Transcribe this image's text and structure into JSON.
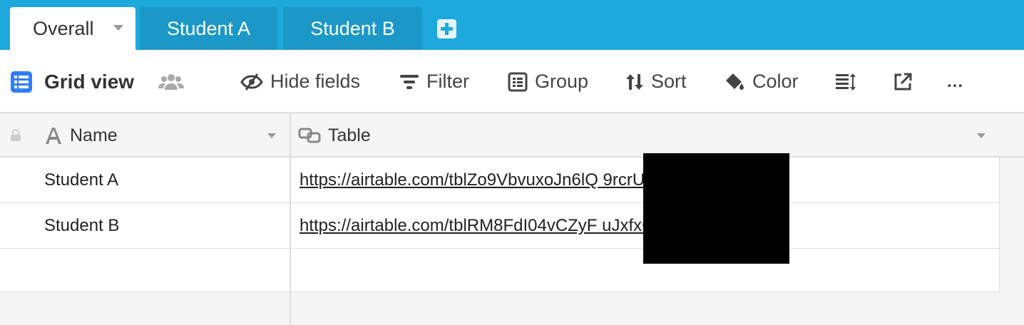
{
  "tabs": [
    {
      "label": "Overall",
      "active": true
    },
    {
      "label": "Student A",
      "active": false
    },
    {
      "label": "Student B",
      "active": false
    }
  ],
  "toolbar": {
    "view_name": "Grid view",
    "hide_fields": "Hide fields",
    "filter": "Filter",
    "group": "Group",
    "sort": "Sort",
    "color": "Color",
    "more": "..."
  },
  "columns": [
    {
      "label": "Name",
      "icon": "text-field-icon"
    },
    {
      "label": "Table",
      "icon": "link-field-icon"
    }
  ],
  "rows": [
    {
      "name": "Student A",
      "url": "https://airtable.com/tblZo9VbvuxoJn6lQ                    9rcrU?blocks=hide"
    },
    {
      "name": "Student B",
      "url": "https://airtable.com/tblRM8FdI04vCZyF                      uJxfxG?blocks=hide"
    }
  ],
  "colors": {
    "tabbar": "#1ea9dc",
    "inactive_tab": "#1b98c7",
    "accent_blue": "#2d7ff9"
  }
}
